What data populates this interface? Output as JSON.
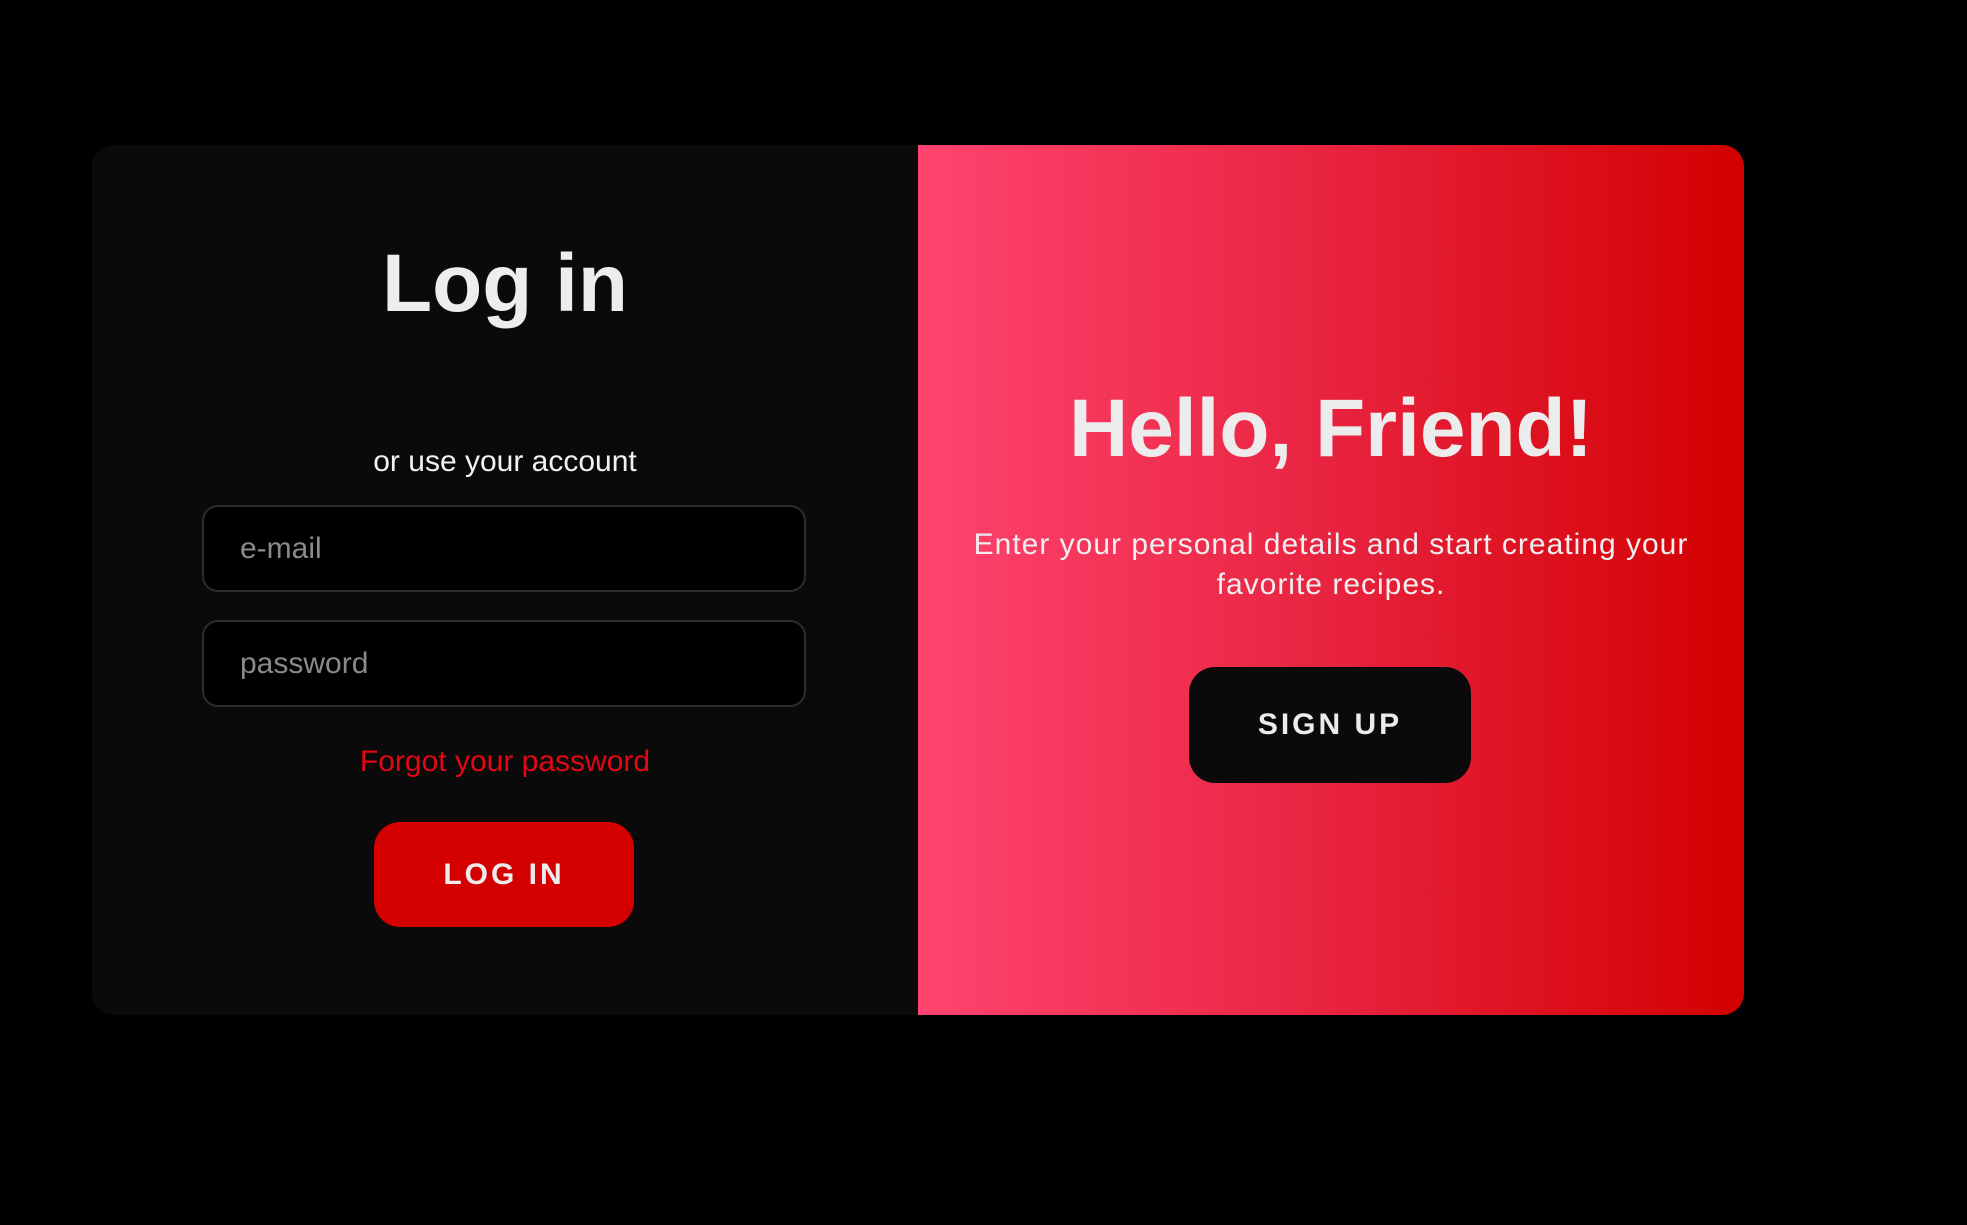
{
  "login": {
    "title": "Log in",
    "alt_text": "or use your account",
    "email_placeholder": "e-mail",
    "password_placeholder": "password",
    "forgot_link": "Forgot your password",
    "login_button": "LOG IN"
  },
  "signup": {
    "title": "Hello, Friend!",
    "text": "Enter your personal details and start creating your favorite recipes.",
    "signup_button": "SIGN UP"
  },
  "colors": {
    "background": "#000000",
    "panel": "#0a0a0a",
    "accent": "#d40000",
    "link": "#e30613",
    "gradient_start": "#ff4470",
    "gradient_end": "#d20000"
  }
}
